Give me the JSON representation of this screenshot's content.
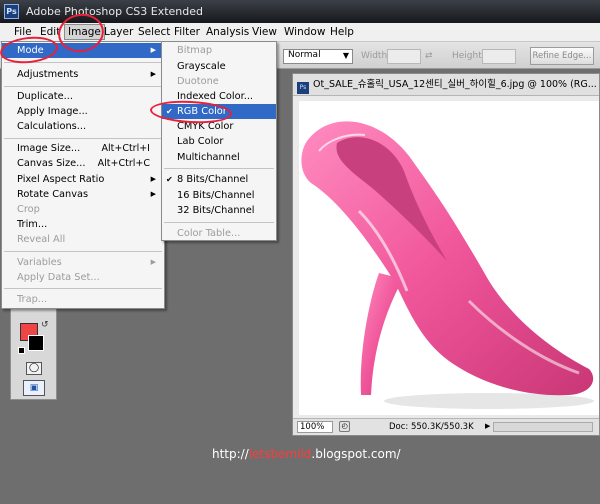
{
  "app": {
    "title": "Adobe Photoshop CS3 Extended",
    "badge": "Ps"
  },
  "menubar": {
    "items": [
      "File",
      "Edit",
      "Image",
      "Layer",
      "Select",
      "Filter",
      "Analysis",
      "View",
      "Window",
      "Help"
    ]
  },
  "options": {
    "style_value": "Normal",
    "width_label": "Width:",
    "height_label": "Height:",
    "refine_edge_label": "Refine Edge..."
  },
  "image_menu": [
    {
      "label": "Mode",
      "active": true,
      "submenu": true
    },
    {
      "separator": true
    },
    {
      "label": "Adjustments",
      "submenu": true
    },
    {
      "separator": true
    },
    {
      "label": "Duplicate..."
    },
    {
      "label": "Apply Image..."
    },
    {
      "label": "Calculations..."
    },
    {
      "separator": true
    },
    {
      "label": "Image Size...",
      "shortcut": "Alt+Ctrl+I"
    },
    {
      "label": "Canvas Size...",
      "shortcut": "Alt+Ctrl+C"
    },
    {
      "label": "Pixel Aspect Ratio",
      "submenu": true
    },
    {
      "label": "Rotate Canvas",
      "submenu": true
    },
    {
      "label": "Crop",
      "disabled": true
    },
    {
      "label": "Trim..."
    },
    {
      "label": "Reveal All",
      "disabled": true
    },
    {
      "separator": true
    },
    {
      "label": "Variables",
      "submenu": true,
      "disabled": true
    },
    {
      "label": "Apply Data Set...",
      "disabled": true
    },
    {
      "separator": true
    },
    {
      "label": "Trap...",
      "disabled": true
    }
  ],
  "mode_submenu": [
    {
      "label": "Bitmap",
      "disabled": true
    },
    {
      "label": "Grayscale"
    },
    {
      "label": "Duotone",
      "disabled": true
    },
    {
      "label": "Indexed Color..."
    },
    {
      "label": "RGB Color",
      "checked": true,
      "active": true
    },
    {
      "label": "CMYK Color"
    },
    {
      "label": "Lab Color"
    },
    {
      "label": "Multichannel"
    },
    {
      "separator": true
    },
    {
      "label": "8 Bits/Channel",
      "checked": true
    },
    {
      "label": "16 Bits/Channel"
    },
    {
      "label": "32 Bits/Channel"
    },
    {
      "separator": true
    },
    {
      "label": "Color Table...",
      "disabled": true
    }
  ],
  "document": {
    "title": "Ot_SALE_슈홀릭_USA_12센티_실버_하이힐_6.jpg @ 100% (RG...",
    "zoom": "100%",
    "doc_size": "Doc: 550.3K/550.3K"
  },
  "colors": {
    "accent": "#3169c6",
    "annotation": "#e8203a",
    "shoe_pink": "#f0559a",
    "foreground": "#f04545",
    "background": "#000000"
  },
  "icons": [
    "swap-colors-icon",
    "quick-mask-icon",
    "screen-mode-icon",
    "doc-status-icon"
  ],
  "watermark": {
    "prefix": "http://",
    "highlight": "letsbemild",
    "suffix": ".blogspot.com/"
  }
}
